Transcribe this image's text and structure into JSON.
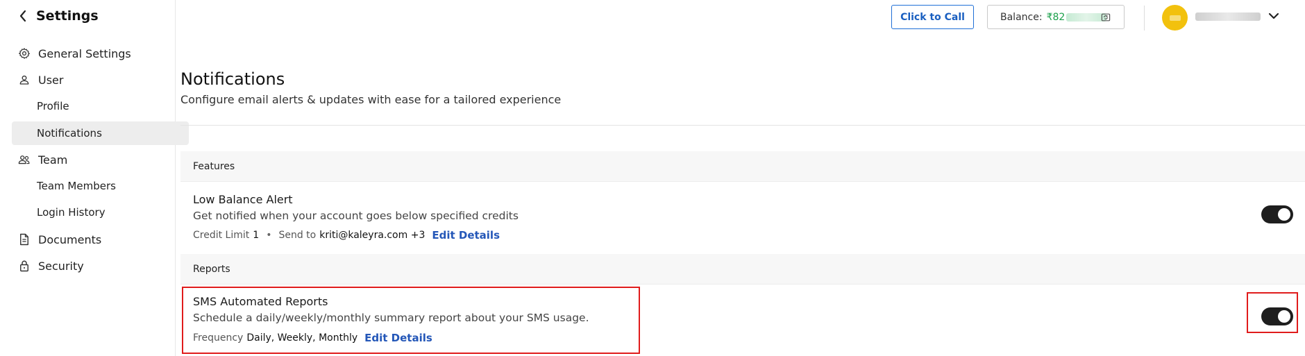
{
  "sidebar": {
    "title": "Settings",
    "items": [
      {
        "label": "General Settings",
        "icon": "gear-icon"
      },
      {
        "label": "User",
        "icon": "user-icon"
      },
      {
        "label": "Profile"
      },
      {
        "label": "Notifications"
      },
      {
        "label": "Team",
        "icon": "team-icon"
      },
      {
        "label": "Team Members"
      },
      {
        "label": "Login History"
      },
      {
        "label": "Documents",
        "icon": "document-icon"
      },
      {
        "label": "Security",
        "icon": "lock-icon"
      }
    ]
  },
  "header": {
    "call_label": "Click to Call",
    "balance_label": "Balance:",
    "balance_amount": "₹82"
  },
  "page": {
    "title": "Notifications",
    "subtitle": "Configure email alerts & updates with ease for a tailored experience"
  },
  "sections": {
    "features": {
      "label": "Features",
      "low_balance": {
        "title": "Low Balance Alert",
        "desc": "Get notified when your account goes below specified credits",
        "credit_label": "Credit Limit",
        "credit_value": "1",
        "bullet": "•",
        "send_label": "Send to",
        "send_value": "kriti@kaleyra.com +3",
        "edit": "Edit Details",
        "enabled": true
      }
    },
    "reports": {
      "label": "Reports",
      "sms_reports": {
        "title": "SMS Automated Reports",
        "desc": "Schedule a daily/weekly/monthly summary report about your SMS usage.",
        "freq_label": "Frequency",
        "freq_value": "Daily, Weekly, Monthly",
        "edit": "Edit Details",
        "enabled": true
      }
    }
  },
  "colors": {
    "accent": "#1f6fd6",
    "balance_green": "#1aa04a",
    "avatar": "#f2c10d",
    "toggle_on": "#1e1e1e",
    "highlight": "#e01b1b"
  }
}
